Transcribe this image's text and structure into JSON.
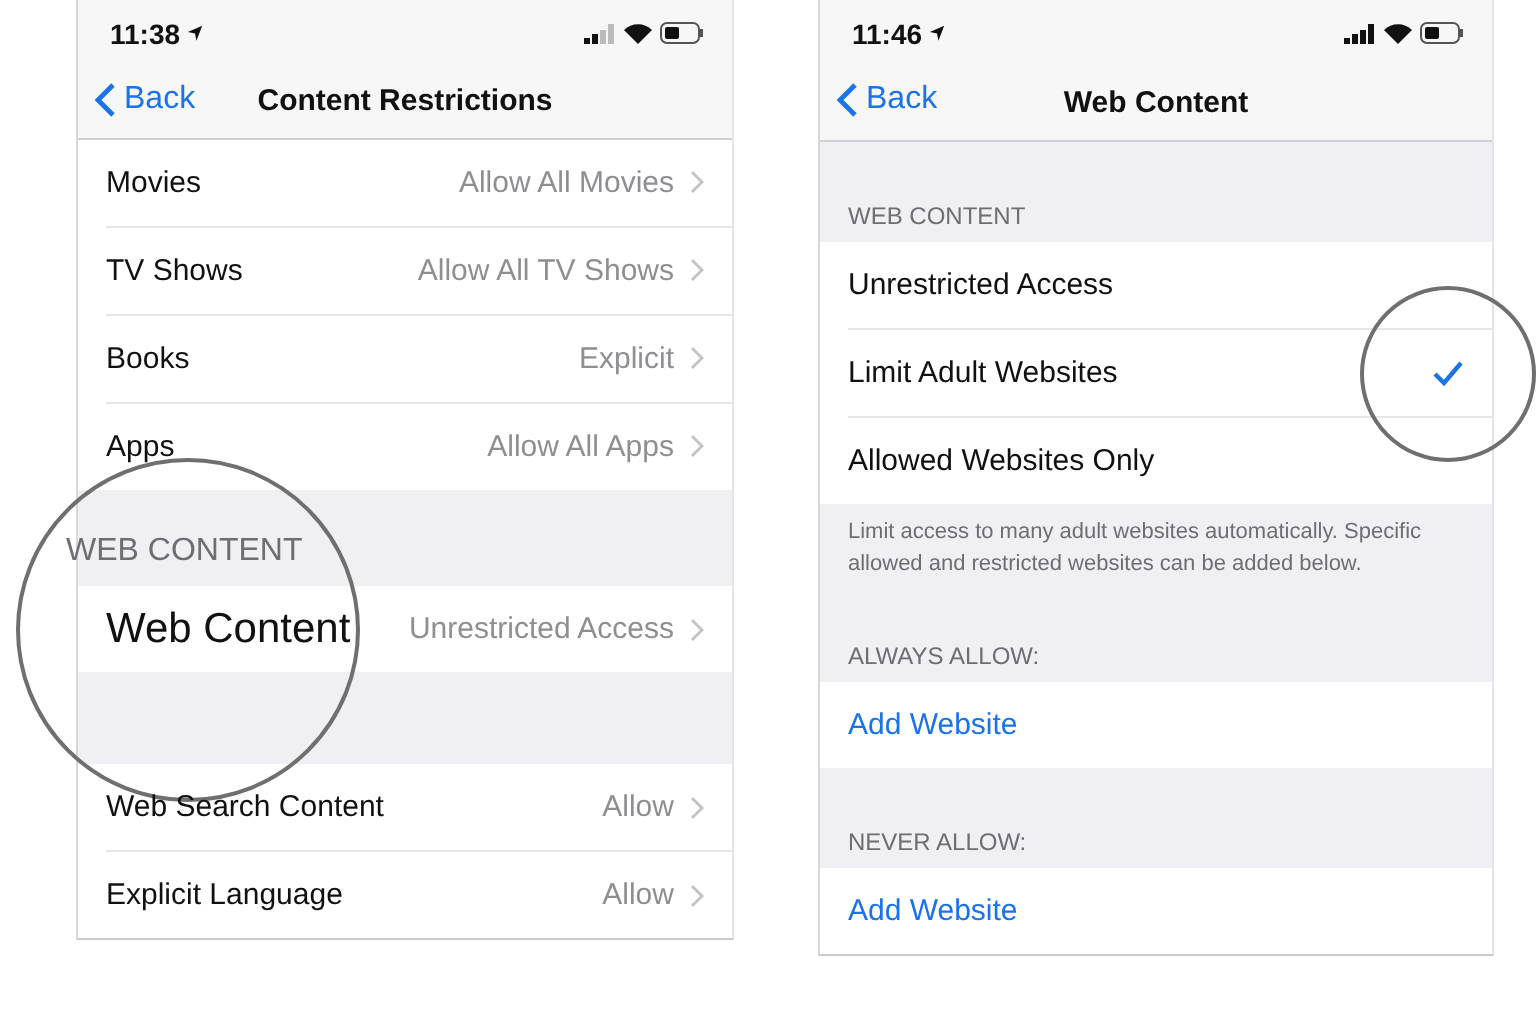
{
  "screens": [
    {
      "time": "11:38",
      "back": "Back",
      "title": "Content Restrictions",
      "sections": [
        {
          "rows": [
            {
              "kind": "disclosure",
              "label": "Movies",
              "value": "Allow All Movies"
            },
            {
              "kind": "disclosure",
              "label": "TV Shows",
              "value": "Allow All TV Shows"
            },
            {
              "kind": "disclosure",
              "label": "Books",
              "value": "Explicit"
            },
            {
              "kind": "disclosure",
              "label": "Apps",
              "value": "Allow All Apps"
            }
          ]
        },
        {
          "header": "WEB CONTENT",
          "magnified": true,
          "rows": [
            {
              "kind": "disclosure",
              "label": "Web Content",
              "value": "Unrestricted Access",
              "magnified": true
            }
          ]
        },
        {
          "rows": [
            {
              "kind": "disclosure",
              "label": "Web Search Content",
              "value": "Allow"
            },
            {
              "kind": "disclosure",
              "label": "Explicit Language",
              "value": "Allow"
            }
          ]
        }
      ]
    },
    {
      "time": "11:46",
      "back": "Back",
      "title": "Web Content",
      "sections": [
        {
          "header": "WEB CONTENT",
          "footer": "Limit access to many adult websites automatically. Specific allowed and restricted websites can be added below.",
          "rows": [
            {
              "kind": "option",
              "label": "Unrestricted Access",
              "selected": false
            },
            {
              "kind": "option",
              "label": "Limit Adult Websites",
              "selected": true,
              "magnified": true
            },
            {
              "kind": "option",
              "label": "Allowed Websites Only",
              "selected": false
            }
          ]
        },
        {
          "header": "ALWAYS ALLOW:",
          "rows": [
            {
              "kind": "link",
              "label": "Add Website"
            }
          ]
        },
        {
          "header": "NEVER ALLOW:",
          "rows": [
            {
              "kind": "link",
              "label": "Add Website"
            }
          ]
        }
      ]
    }
  ]
}
